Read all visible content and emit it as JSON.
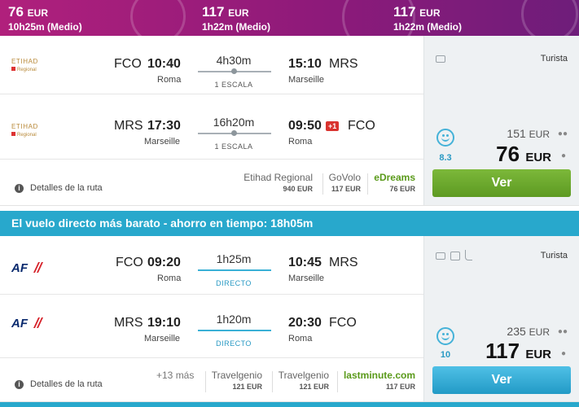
{
  "banner": [
    {
      "price": "76",
      "currency": "EUR",
      "duration": "10h25m (Medio)"
    },
    {
      "price": "117",
      "currency": "EUR",
      "duration": "1h22m (Medio)"
    },
    {
      "price": "117",
      "currency": "EUR",
      "duration": "1h22m (Medio)"
    }
  ],
  "result1": {
    "airline_logo_text": "ETIHAD",
    "airline_logo_sub": "Regional",
    "legs": [
      {
        "from_code": "FCO",
        "dep_time": "10:40",
        "from_city": "Roma",
        "duration": "4h30m",
        "stops": "1 ESCALA",
        "arr_time": "15:10",
        "to_code": "MRS",
        "to_city": "Marseille",
        "day_offset": ""
      },
      {
        "from_code": "MRS",
        "dep_time": "17:30",
        "from_city": "Marseille",
        "duration": "16h20m",
        "stops": "1 ESCALA",
        "arr_time": "09:50",
        "to_code": "FCO",
        "to_city": "Roma",
        "day_offset": "+1"
      }
    ],
    "details_link": "Detalles de la ruta",
    "providers": [
      {
        "name": "Etihad Regional",
        "price": "940 EUR"
      },
      {
        "name": "GoVolo",
        "price": "117 EUR"
      },
      {
        "name": "eDreams",
        "price": "76 EUR"
      }
    ],
    "cabin": "Turista",
    "score": "8.3",
    "group_price": "151",
    "group_currency": "EUR",
    "price": "76",
    "currency": "EUR",
    "button": "Ver"
  },
  "section_header": "El vuelo directo más barato - ahorro en tiempo: 18h05m",
  "result2": {
    "airline_logo_text": "AF",
    "legs": [
      {
        "from_code": "FCO",
        "dep_time": "09:20",
        "from_city": "Roma",
        "duration": "1h25m",
        "stops": "DIRECTO",
        "arr_time": "10:45",
        "to_code": "MRS",
        "to_city": "Marseille"
      },
      {
        "from_code": "MRS",
        "dep_time": "19:10",
        "from_city": "Marseille",
        "duration": "1h20m",
        "stops": "DIRECTO",
        "arr_time": "20:30",
        "to_code": "FCO",
        "to_city": "Roma"
      }
    ],
    "details_link": "Detalles de la ruta",
    "more": "+13 más",
    "providers": [
      {
        "name": "Travelgenio",
        "price": "121 EUR"
      },
      {
        "name": "Travelgenio",
        "price": "121 EUR"
      },
      {
        "name": "lastminute.com",
        "price": "117 EUR"
      }
    ],
    "cabin": "Turista",
    "score": "10",
    "group_price": "235",
    "group_currency": "EUR",
    "price": "117",
    "currency": "EUR",
    "button": "Ver"
  },
  "colors": {
    "banner": "#9a1c7b",
    "accent_blue": "#28a8cc",
    "green_button": "#6aa82e",
    "best_provider": "#5a9a1a"
  }
}
